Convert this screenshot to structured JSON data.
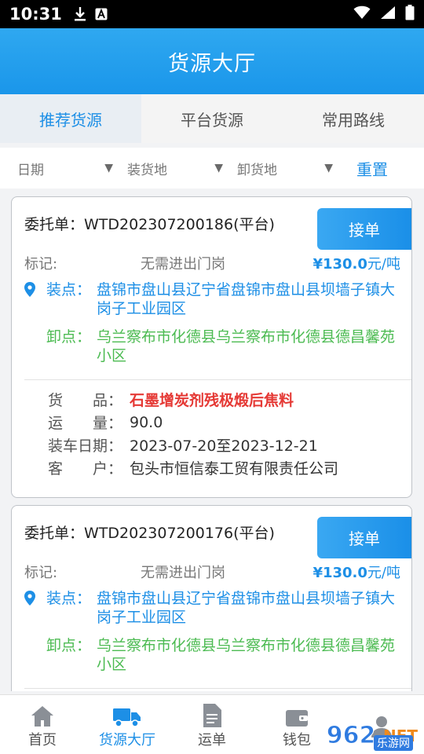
{
  "status_bar": {
    "time": "10:31"
  },
  "header": {
    "title": "货源大厅"
  },
  "tabs": [
    {
      "label": "推荐货源",
      "active": true
    },
    {
      "label": "平台货源",
      "active": false
    },
    {
      "label": "常用路线",
      "active": false
    }
  ],
  "filters": {
    "date": "日期",
    "load_place": "装货地",
    "unload_place": "卸货地",
    "reset": "重置"
  },
  "cards": [
    {
      "order": "委托单：WTD202307200186(平台)",
      "accept": "接单",
      "mark_label": "标记:",
      "mark_value": "无需进出门岗",
      "price": "¥130.0",
      "price_unit": "元/吨",
      "load_label": "装点：",
      "load_addr": "盘锦市盘山县辽宁省盘锦市盘山县坝墙子镇大岗子工业园区",
      "unload_label": "卸点：",
      "unload_addr": "乌兰察布市化德县乌兰察布市化德县德昌馨苑小区",
      "goods_label": "货　　品：",
      "goods": "石墨增炭剂残极煅后焦料",
      "qty_label": "运　　量：",
      "qty": "90.0",
      "date_label": "装车日期：",
      "date": "2023-07-20至2023-12-21",
      "customer_label": "客　　户：",
      "customer": "包头市恒信泰工贸有限责任公司"
    },
    {
      "order": "委托单：WTD202307200176(平台)",
      "accept": "接单",
      "mark_label": "标记:",
      "mark_value": "无需进出门岗",
      "price": "¥130.0",
      "price_unit": "元/吨",
      "load_label": "装点：",
      "load_addr": "盘锦市盘山县辽宁省盘锦市盘山县坝墙子镇大岗子工业园区",
      "unload_label": "卸点：",
      "unload_addr": "乌兰察布市化德县乌兰察布市化德县德昌馨苑小区"
    }
  ],
  "bottom_nav": [
    {
      "label": "首页",
      "icon": "home-icon",
      "active": false
    },
    {
      "label": "货源大厅",
      "icon": "truck-icon",
      "active": true
    },
    {
      "label": "运单",
      "icon": "document-icon",
      "active": false
    },
    {
      "label": "钱包",
      "icon": "wallet-icon",
      "active": false
    }
  ],
  "watermark": {
    "brand": "962",
    "tld": ".NET",
    "sub": "乐游网"
  },
  "colors": {
    "accent": "#1d8fe6",
    "load": "#1d8fe6",
    "unload": "#4cbb52",
    "goods": "#e53935"
  }
}
